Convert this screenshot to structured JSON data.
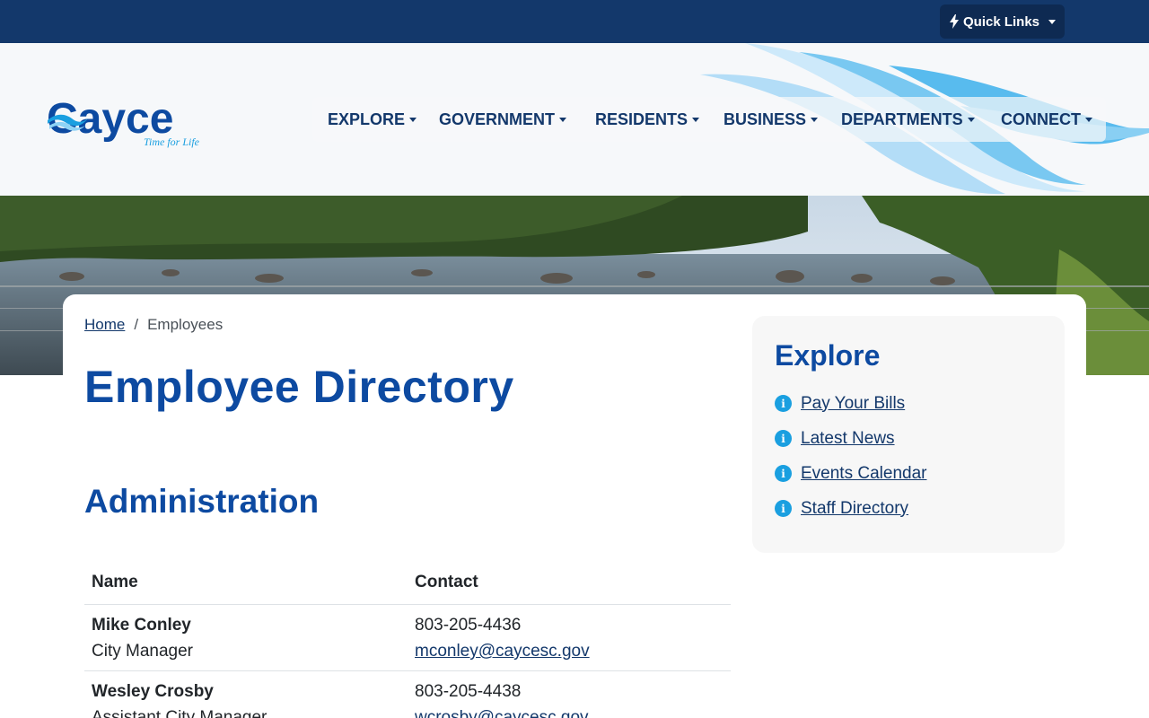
{
  "topbar": {
    "quick_links_label": "Quick Links"
  },
  "logo": {
    "name": "Cayce",
    "tagline": "Time for Life"
  },
  "nav": {
    "items": [
      {
        "label": "EXPLORE"
      },
      {
        "label": "GOVERNMENT"
      },
      {
        "label": "RESIDENTS"
      },
      {
        "label": "BUSINESS"
      },
      {
        "label": "DEPARTMENTS"
      },
      {
        "label": "CONNECT"
      }
    ]
  },
  "breadcrumb": {
    "home": "Home",
    "separator": "/",
    "current": "Employees"
  },
  "page": {
    "title": "Employee Directory",
    "section": "Administration"
  },
  "table": {
    "headers": [
      "Name",
      "Contact"
    ],
    "rows": [
      {
        "name": "Mike Conley",
        "title": "City Manager",
        "phone": "803-205-4436",
        "email": "mconley@caycesc.gov"
      },
      {
        "name": "Wesley Crosby",
        "title": "Assistant City Manager",
        "phone": "803-205-4438",
        "email": "wcrosby@caycesc.gov"
      }
    ]
  },
  "sidebar": {
    "title": "Explore",
    "links": [
      {
        "label": "Pay Your Bills",
        "icon": "info-icon"
      },
      {
        "label": "Latest News",
        "icon": "info-icon"
      },
      {
        "label": "Events Calendar",
        "icon": "info-icon"
      },
      {
        "label": "Staff Directory",
        "icon": "info-icon"
      }
    ]
  },
  "colors": {
    "topbar": "#13386b",
    "brand_blue": "#0d4aa1",
    "accent_cyan": "#1a9fe0",
    "link": "#13386b"
  }
}
